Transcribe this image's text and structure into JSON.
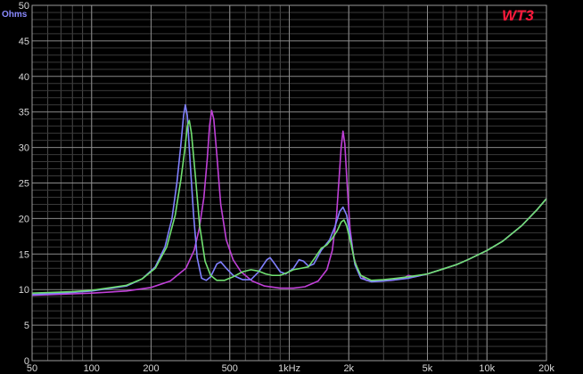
{
  "chart_data": {
    "type": "line",
    "title": "",
    "badge": "WT3",
    "ylabel": "Ohms",
    "xlabel": "",
    "x_scale": "log",
    "xlim": [
      50,
      20000
    ],
    "ylim": [
      0,
      50
    ],
    "grid": true,
    "background": "#000000",
    "y_ticks": [
      0,
      5,
      10,
      15,
      20,
      25,
      30,
      35,
      40,
      45,
      50
    ],
    "x_ticks": [
      {
        "value": 50,
        "label": "50"
      },
      {
        "value": 100,
        "label": "100"
      },
      {
        "value": 200,
        "label": "200"
      },
      {
        "value": 500,
        "label": "500"
      },
      {
        "value": 1000,
        "label": "1kHz"
      },
      {
        "value": 2000,
        "label": "2k"
      },
      {
        "value": 5000,
        "label": "5k"
      },
      {
        "value": 10000,
        "label": "10k"
      },
      {
        "value": 20000,
        "label": "20k"
      }
    ],
    "series": [
      {
        "color": "#c040d8",
        "points": [
          [
            50,
            9.2
          ],
          [
            80,
            9.4
          ],
          [
            100,
            9.5
          ],
          [
            150,
            9.8
          ],
          [
            200,
            10.3
          ],
          [
            250,
            11.2
          ],
          [
            300,
            13.0
          ],
          [
            330,
            15.5
          ],
          [
            350,
            18.5
          ],
          [
            370,
            23.0
          ],
          [
            385,
            28.5
          ],
          [
            395,
            33.0
          ],
          [
            405,
            35.2
          ],
          [
            415,
            34.0
          ],
          [
            430,
            29.0
          ],
          [
            450,
            22.0
          ],
          [
            480,
            17.0
          ],
          [
            520,
            14.2
          ],
          [
            570,
            12.5
          ],
          [
            650,
            11.2
          ],
          [
            750,
            10.5
          ],
          [
            900,
            10.2
          ],
          [
            1050,
            10.2
          ],
          [
            1200,
            10.4
          ],
          [
            1400,
            11.2
          ],
          [
            1550,
            12.8
          ],
          [
            1650,
            15.5
          ],
          [
            1730,
            20.0
          ],
          [
            1780,
            25.0
          ],
          [
            1830,
            30.0
          ],
          [
            1870,
            32.3
          ],
          [
            1910,
            30.5
          ],
          [
            1960,
            25.0
          ],
          [
            2030,
            18.5
          ],
          [
            2120,
            14.5
          ],
          [
            2250,
            12.3
          ],
          [
            2450,
            11.3
          ],
          [
            2800,
            11.2
          ],
          [
            3300,
            11.3
          ],
          [
            3800,
            11.6
          ],
          [
            4000,
            12.0
          ],
          [
            4300,
            11.8
          ],
          [
            5000,
            12.2
          ],
          [
            6000,
            12.9
          ],
          [
            7000,
            13.5
          ],
          [
            8000,
            14.2
          ],
          [
            10000,
            15.5
          ],
          [
            12000,
            16.8
          ],
          [
            15000,
            19.0
          ],
          [
            18000,
            21.3
          ],
          [
            20000,
            22.8
          ]
        ]
      },
      {
        "color": "#8080ff",
        "points": [
          [
            50,
            9.3
          ],
          [
            80,
            9.6
          ],
          [
            100,
            9.8
          ],
          [
            150,
            10.5
          ],
          [
            180,
            11.5
          ],
          [
            210,
            13.2
          ],
          [
            235,
            16.0
          ],
          [
            255,
            20.0
          ],
          [
            270,
            25.0
          ],
          [
            282,
            30.0
          ],
          [
            292,
            34.5
          ],
          [
            298,
            36.0
          ],
          [
            305,
            34.5
          ],
          [
            315,
            28.0
          ],
          [
            328,
            20.5
          ],
          [
            342,
            14.5
          ],
          [
            360,
            11.6
          ],
          [
            380,
            11.3
          ],
          [
            400,
            11.8
          ],
          [
            430,
            13.6
          ],
          [
            450,
            13.9
          ],
          [
            480,
            13.0
          ],
          [
            520,
            12.0
          ],
          [
            580,
            11.4
          ],
          [
            640,
            11.4
          ],
          [
            700,
            12.5
          ],
          [
            770,
            14.2
          ],
          [
            800,
            14.5
          ],
          [
            850,
            13.5
          ],
          [
            900,
            12.5
          ],
          [
            960,
            12.2
          ],
          [
            1050,
            13.0
          ],
          [
            1120,
            14.2
          ],
          [
            1180,
            14.0
          ],
          [
            1250,
            13.3
          ],
          [
            1330,
            13.6
          ],
          [
            1450,
            15.5
          ],
          [
            1600,
            17.0
          ],
          [
            1700,
            18.8
          ],
          [
            1800,
            21.0
          ],
          [
            1870,
            21.6
          ],
          [
            1950,
            20.5
          ],
          [
            2050,
            17.0
          ],
          [
            2150,
            13.5
          ],
          [
            2300,
            11.6
          ],
          [
            2600,
            11.1
          ],
          [
            3000,
            11.2
          ],
          [
            3500,
            11.4
          ],
          [
            4000,
            11.6
          ],
          [
            5000,
            12.2
          ],
          [
            6000,
            12.9
          ],
          [
            7000,
            13.5
          ],
          [
            8000,
            14.2
          ],
          [
            10000,
            15.5
          ],
          [
            12000,
            16.8
          ],
          [
            15000,
            19.0
          ],
          [
            18000,
            21.3
          ],
          [
            20000,
            22.8
          ]
        ]
      },
      {
        "color": "#70e070",
        "points": [
          [
            50,
            9.5
          ],
          [
            80,
            9.7
          ],
          [
            100,
            9.9
          ],
          [
            150,
            10.6
          ],
          [
            180,
            11.5
          ],
          [
            210,
            13.0
          ],
          [
            240,
            16.0
          ],
          [
            265,
            20.5
          ],
          [
            283,
            25.5
          ],
          [
            297,
            30.0
          ],
          [
            305,
            33.0
          ],
          [
            312,
            33.8
          ],
          [
            320,
            32.0
          ],
          [
            335,
            26.0
          ],
          [
            352,
            19.0
          ],
          [
            375,
            14.0
          ],
          [
            400,
            12.0
          ],
          [
            430,
            11.3
          ],
          [
            470,
            11.3
          ],
          [
            520,
            11.8
          ],
          [
            580,
            12.5
          ],
          [
            640,
            12.8
          ],
          [
            700,
            12.6
          ],
          [
            760,
            12.2
          ],
          [
            820,
            12.0
          ],
          [
            900,
            12.0
          ],
          [
            980,
            12.4
          ],
          [
            1050,
            12.8
          ],
          [
            1150,
            13.0
          ],
          [
            1250,
            13.2
          ],
          [
            1350,
            14.5
          ],
          [
            1450,
            15.8
          ],
          [
            1550,
            16.3
          ],
          [
            1650,
            17.2
          ],
          [
            1750,
            18.3
          ],
          [
            1830,
            19.5
          ],
          [
            1890,
            19.8
          ],
          [
            1950,
            19.0
          ],
          [
            2050,
            16.5
          ],
          [
            2150,
            13.8
          ],
          [
            2300,
            12.0
          ],
          [
            2600,
            11.3
          ],
          [
            3000,
            11.4
          ],
          [
            3500,
            11.6
          ],
          [
            4000,
            11.8
          ],
          [
            5000,
            12.2
          ],
          [
            6000,
            12.9
          ],
          [
            7000,
            13.5
          ],
          [
            8000,
            14.2
          ],
          [
            10000,
            15.5
          ],
          [
            12000,
            16.8
          ],
          [
            15000,
            19.0
          ],
          [
            18000,
            21.3
          ],
          [
            20000,
            22.8
          ]
        ]
      }
    ]
  }
}
